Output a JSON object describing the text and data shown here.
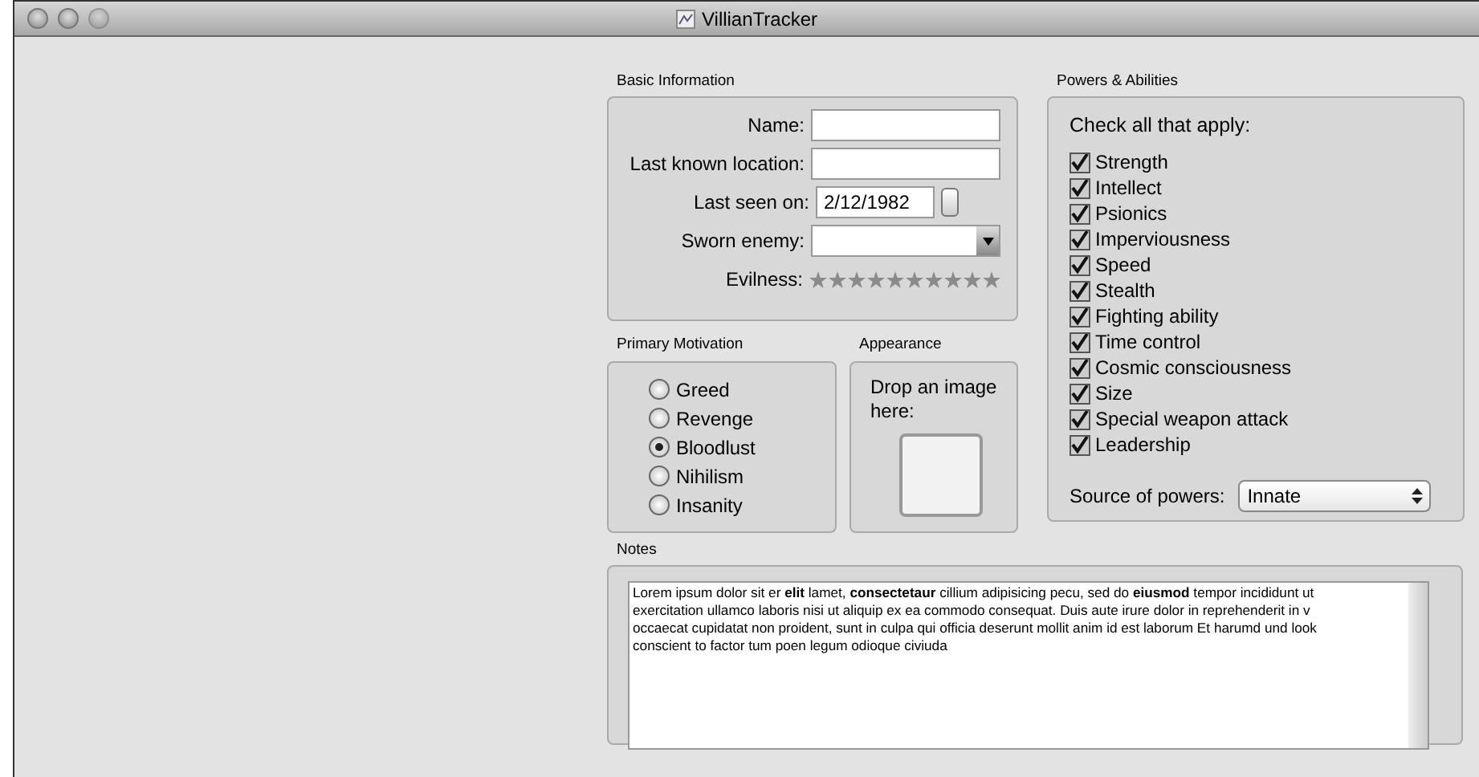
{
  "window": {
    "title": "VillianTracker"
  },
  "basic_information": {
    "title": "Basic Information",
    "name": {
      "label": "Name:"
    },
    "last_known_location": {
      "label": "Last known location:"
    },
    "last_seen_on": {
      "label": "Last seen on:",
      "value": "2/12/1982"
    },
    "sworn_enemy": {
      "label": "Sworn enemy:"
    },
    "evilness": {
      "label": "Evilness:",
      "stars": 0
    }
  },
  "primary_motivation": {
    "title": "Primary Motivation",
    "options": [
      {
        "label": "Greed",
        "selected": false
      },
      {
        "label": "Revenge",
        "selected": false
      },
      {
        "label": "Bloodlust",
        "selected": true
      },
      {
        "label": "Nihilism",
        "selected": false
      },
      {
        "label": "Insanity",
        "selected": false
      }
    ]
  },
  "appearance": {
    "title": "Appearance",
    "hint": "Drop an image here:"
  },
  "powers": {
    "title": "Powers & Abilities",
    "instruction": "Check all that apply:",
    "items": [
      {
        "label": "Strength",
        "checked": true
      },
      {
        "label": "Intellect",
        "checked": true
      },
      {
        "label": "Psionics",
        "checked": true
      },
      {
        "label": "Imperviousness",
        "checked": true
      },
      {
        "label": "Speed",
        "checked": true
      },
      {
        "label": "Stealth",
        "checked": true
      },
      {
        "label": "Fighting ability",
        "checked": true
      },
      {
        "label": "Time control",
        "checked": true
      },
      {
        "label": "Cosmic consciousness",
        "checked": true
      },
      {
        "label": "Size",
        "checked": true
      },
      {
        "label": "Special weapon attack",
        "checked": true
      },
      {
        "label": "Leadership",
        "checked": true
      }
    ],
    "source": {
      "label": "Source of powers:",
      "value": "Innate"
    }
  },
  "notes": {
    "title": "Notes",
    "lines": [
      "Lorem ipsum dolor sit er **elit** lamet, **consectetaur** cillium adipisicing pecu, sed do **eiusmod** tempor incididunt ut",
      "exercitation ullamco laboris nisi ut aliquip ex ea commodo consequat. Duis aute irure dolor in reprehenderit in v",
      "occaecat cupidatat non proident, sunt in culpa qui officia deserunt mollit anim id est laborum Et harumd und look",
      "conscient to factor tum poen legum odioque civiuda"
    ]
  }
}
